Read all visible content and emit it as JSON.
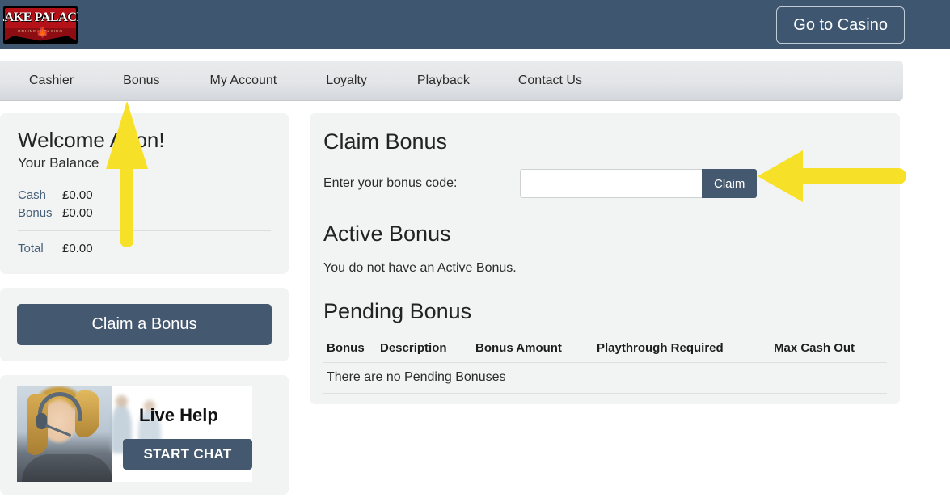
{
  "header": {
    "logo": {
      "word": "LAKE PALACE",
      "left_sub": "ONLINE",
      "right_sub": "CASINO",
      "leaf_icon": "maple-leaf-icon"
    },
    "casino_button": "Go to Casino",
    "background_color": "#3f5670"
  },
  "nav": {
    "items": [
      {
        "label": "Cashier"
      },
      {
        "label": "Bonus"
      },
      {
        "label": "My Account"
      },
      {
        "label": "Loyalty"
      },
      {
        "label": "Playback"
      },
      {
        "label": "Contact Us"
      }
    ]
  },
  "sidebar": {
    "welcome_title": "Welcome Adon!",
    "balance_heading": "Your Balance",
    "balance_rows": [
      {
        "label": "Cash",
        "value": "£0.00"
      },
      {
        "label": "Bonus",
        "value": "£0.00"
      }
    ],
    "total": {
      "label": "Total",
      "value": "£0.00"
    },
    "claim_bonus_button": "Claim a Bonus",
    "live_help": {
      "title": "Live Help",
      "button": "START CHAT"
    }
  },
  "main": {
    "claim_bonus": {
      "title": "Claim Bonus",
      "code_label": "Enter your bonus code:",
      "code_value": "",
      "code_placeholder": "",
      "claim_button": "Claim"
    },
    "active_bonus": {
      "title": "Active Bonus",
      "empty_message": "You do not have an Active Bonus."
    },
    "pending_bonus": {
      "title": "Pending Bonus",
      "columns": [
        "Bonus",
        "Description",
        "Bonus Amount",
        "Playthrough Required",
        "Max Cash Out"
      ],
      "empty_message": "There are no Pending Bonuses"
    }
  },
  "annotations": {
    "arrow_color": "#F7E028",
    "arrow_up": {
      "name": "arrow-pointing-to-bonus-nav",
      "direction": "up"
    },
    "arrow_left": {
      "name": "arrow-pointing-to-claim-button",
      "direction": "left"
    }
  },
  "colors": {
    "header_bg": "#3f5670",
    "nav_bg": "#e5e7ea",
    "panel_bg": "#f2f3f3",
    "button_bg": "#44586f",
    "accent_yellow": "#F7E028",
    "logo_red": "#b41118",
    "label_blue": "#47607a"
  }
}
